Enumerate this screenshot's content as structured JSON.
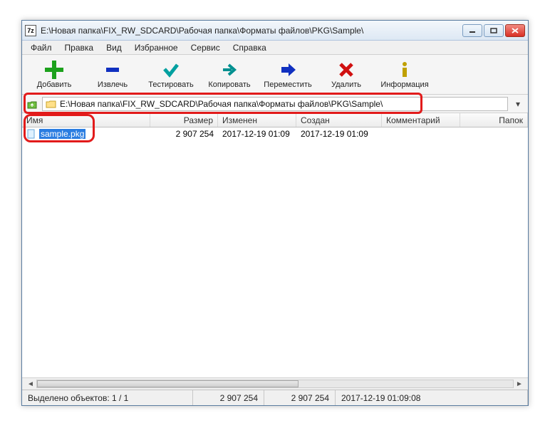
{
  "window": {
    "app_icon_label": "7z",
    "title": "E:\\Новая папка\\FIX_RW_SDCARD\\Рабочая папка\\Форматы файлов\\PKG\\Sample\\"
  },
  "menus": [
    "Файл",
    "Правка",
    "Вид",
    "Избранное",
    "Сервис",
    "Справка"
  ],
  "toolbar": [
    {
      "label": "Добавить",
      "icon": "plus",
      "color": "#1ca11c"
    },
    {
      "label": "Извлечь",
      "icon": "minus",
      "color": "#1030c0"
    },
    {
      "label": "Тестировать",
      "icon": "check",
      "color": "#00a0a0"
    },
    {
      "label": "Копировать",
      "icon": "arrow-right",
      "color": "#009090"
    },
    {
      "label": "Переместить",
      "icon": "arrow-right-solid",
      "color": "#1030c0"
    },
    {
      "label": "Удалить",
      "icon": "x",
      "color": "#d01010"
    },
    {
      "label": "Информация",
      "icon": "info",
      "color": "#c0a000"
    }
  ],
  "address": {
    "path": "E:\\Новая папка\\FIX_RW_SDCARD\\Рабочая папка\\Форматы файлов\\PKG\\Sample\\"
  },
  "columns": {
    "name": "Имя",
    "size": "Размер",
    "modified": "Изменен",
    "created": "Создан",
    "comment": "Комментарий",
    "folders": "Папок"
  },
  "files": [
    {
      "name": "sample.pkg",
      "size": "2 907 254",
      "modified": "2017-12-19 01:09",
      "created": "2017-12-19 01:09",
      "selected": true
    }
  ],
  "status": {
    "selection": "Выделено объектов: 1 / 1",
    "size1": "2 907 254",
    "size2": "2 907 254",
    "datetime": "2017-12-19 01:09:08"
  }
}
